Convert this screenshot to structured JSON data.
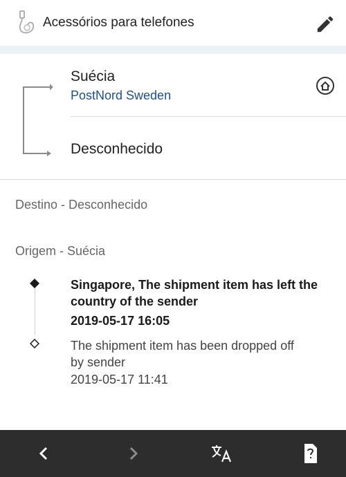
{
  "header": {
    "title": "Acessórios para telefones",
    "icon": "phone-accessory-icon",
    "edit_icon": "pencil-icon"
  },
  "route": {
    "origin_country": "Suécia",
    "carrier": "PostNord Sweden",
    "destination_country": "Desconhecido",
    "home_icon": "home-icon"
  },
  "sections": {
    "destination_label": "Destino - Desconhecido",
    "origin_label": "Origem - Suécia"
  },
  "events": [
    {
      "description": "Singapore, The shipment item has left the country of the sender",
      "timestamp": "2019-05-17 16:05",
      "marker": "filled-diamond"
    },
    {
      "description": "The shipment item has been dropped off by sender",
      "timestamp": "2019-05-17 11:41",
      "marker": "hollow-diamond"
    }
  ],
  "bottom_bar": {
    "buttons": [
      "back-icon",
      "forward-icon",
      "translate-icon",
      "help-icon"
    ]
  },
  "colors": {
    "accent_link": "#1d4f91",
    "band": "#eef2f9",
    "bottom_bar": "#2d2d2d"
  }
}
